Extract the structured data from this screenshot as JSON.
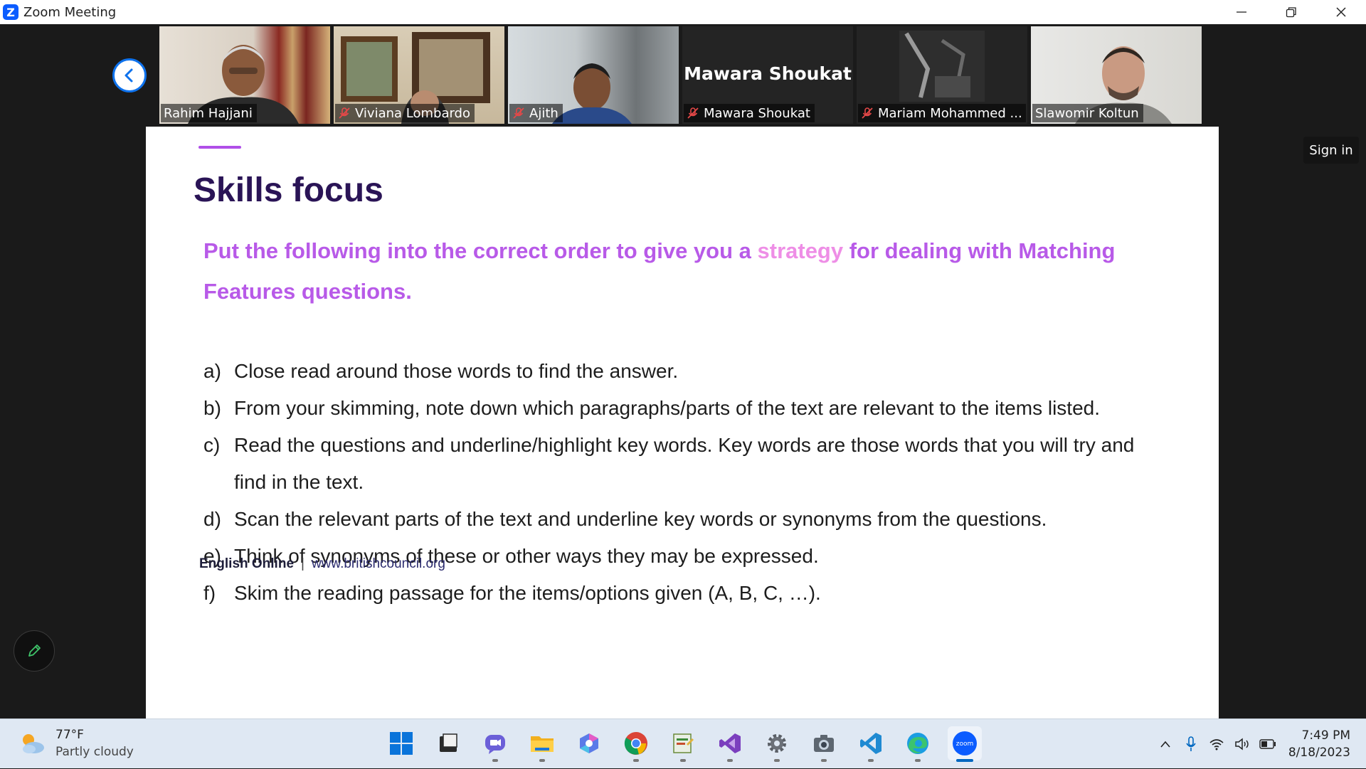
{
  "window": {
    "title": "Zoom Meeting",
    "logo_letter": "Z",
    "controls": [
      "minimize-icon",
      "restore-icon",
      "close-icon"
    ]
  },
  "participants": [
    {
      "name": "Rahim Hajjani",
      "muted": false,
      "active_speaker": true,
      "video": true
    },
    {
      "name": "Viviana Lombardo",
      "muted": true,
      "active_speaker": false,
      "video": true
    },
    {
      "name": "Ajith",
      "muted": true,
      "active_speaker": false,
      "video": true
    },
    {
      "name": "Mawara Shoukat",
      "muted": true,
      "active_speaker": false,
      "video": false,
      "display_name": "Mawara Shoukat"
    },
    {
      "name": "Mariam Mohammed ...",
      "muted": true,
      "active_speaker": false,
      "video": true
    },
    {
      "name": "Slawomir Koltun",
      "muted": false,
      "active_speaker": false,
      "video": true
    }
  ],
  "slide": {
    "title": "Skills focus",
    "intro_part1": "Put the following into the correct order to give you a ",
    "intro_highlight": "strategy",
    "intro_part2": " for dealing with Matching Features questions.",
    "options": [
      {
        "letter": "a)",
        "text": "Close read around those words to find the answer."
      },
      {
        "letter": "b)",
        "text": "From your skimming, note down which paragraphs/parts of the text are relevant to the items listed."
      },
      {
        "letter": "c)",
        "text": "Read the questions and underline/highlight key words. Key words are those words that you will try and find in the text."
      },
      {
        "letter": "d)",
        "text": "Scan the relevant parts of the text and underline key words or synonyms from the questions."
      },
      {
        "letter": "e)",
        "text": "Think of synonyms of these or other ways they may be expressed."
      },
      {
        "letter": "f)",
        "text": "Skim the reading passage for the items/options given (A, B, C, …)."
      }
    ],
    "footer_brand": "English Online",
    "footer_sep": "|",
    "footer_url": "www.britishcouncil.org"
  },
  "sign_in_label": "Sign in",
  "taskbar": {
    "weather_temp": "77°F",
    "weather_desc": "Partly cloudy",
    "apps": [
      "windows-start-icon",
      "file-manager-icon",
      "teams-chat-icon",
      "file-explorer-icon",
      "copilot-icon",
      "chrome-icon",
      "editor-icon",
      "visual-studio-icon",
      "settings-icon",
      "camera-icon",
      "vscode-icon",
      "edge-icon",
      "zoom-icon"
    ],
    "time": "7:49 PM",
    "date": "8/18/2023"
  },
  "colors": {
    "accent_purple": "#b85ae8",
    "highlight_pink": "#ee8ee6",
    "title_navy": "#2a1456",
    "zoom_blue": "#0b5cff",
    "active_speaker_border": "#8bc34a"
  }
}
